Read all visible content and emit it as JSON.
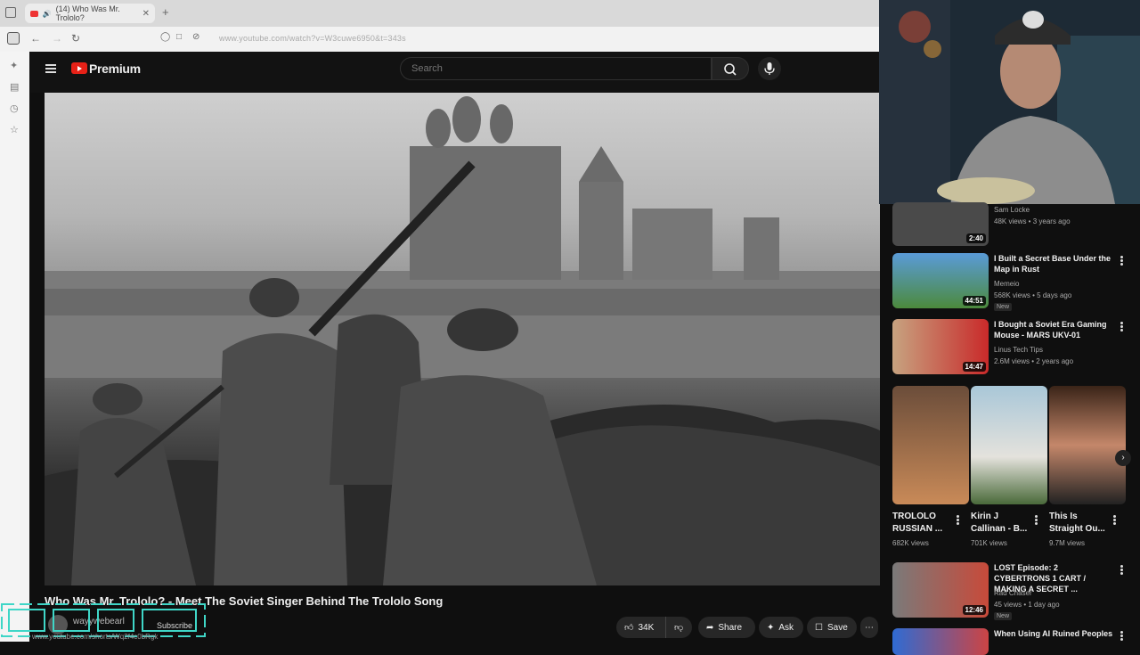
{
  "browser": {
    "tab_title": "(14) Who Was Mr. Trololo?",
    "new_tab": "+",
    "url": "www.youtube.com/watch?v=W3cuwe6950&t=343s",
    "status_url": "www.youtube.com/shorts/Wq2f4c0bRgk"
  },
  "header": {
    "brand": "Premium",
    "search_placeholder": "Search"
  },
  "video": {
    "title": "Who Was Mr. Trololo? - Meet The Soviet Singer Behind The Trololo Song",
    "channel": "wayywebearl",
    "subscribe_label": "Subscribe",
    "like_count": "34K",
    "share_label": "Share",
    "ask_label": "Ask",
    "save_label": "Save"
  },
  "recommended": [
    {
      "title": "",
      "channel": "Sam Locke",
      "meta": "48K views • 3 years ago",
      "duration": "2:40",
      "badge": ""
    },
    {
      "title": "I Built a Secret Base Under the Map in Rust",
      "channel": "Memeio",
      "meta": "568K views • 5 days ago",
      "duration": "44:51",
      "badge": "New"
    },
    {
      "title": "I Bought a Soviet Era Gaming Mouse - MARS UKV-01",
      "channel": "Linus Tech Tips",
      "meta": "2.6M views • 2 years ago",
      "duration": "14:47",
      "badge": ""
    },
    {
      "title": "LOST Episode: 2 CYBERTRONS 1 CART / MAKING A SECRET ...",
      "channel": "Rad Chaser",
      "meta": "45 views • 1 day ago",
      "duration": "12:46",
      "badge": "New"
    },
    {
      "title": "When Using AI Ruined Peoples",
      "channel": "",
      "meta": "",
      "duration": "",
      "badge": ""
    }
  ],
  "shorts": [
    {
      "title": "TROLOLO RUSSIAN ...",
      "views": "682K views"
    },
    {
      "title": "Kirin J Callinan - B...",
      "views": "701K views"
    },
    {
      "title": "This Is Straight Ou...",
      "views": "9.7M views"
    }
  ],
  "icons": {
    "hamburger": "menu-icon",
    "search": "search-icon",
    "mic": "mic-icon",
    "like": "thumbs-up-icon",
    "dislike": "thumbs-down-icon",
    "share": "share-icon",
    "ask": "sparkle-icon",
    "save": "bookmark-icon",
    "more": "more-icon"
  },
  "colors": {
    "yt_red": "#e62117",
    "background": "#0f0f0f",
    "pill": "#272727"
  }
}
